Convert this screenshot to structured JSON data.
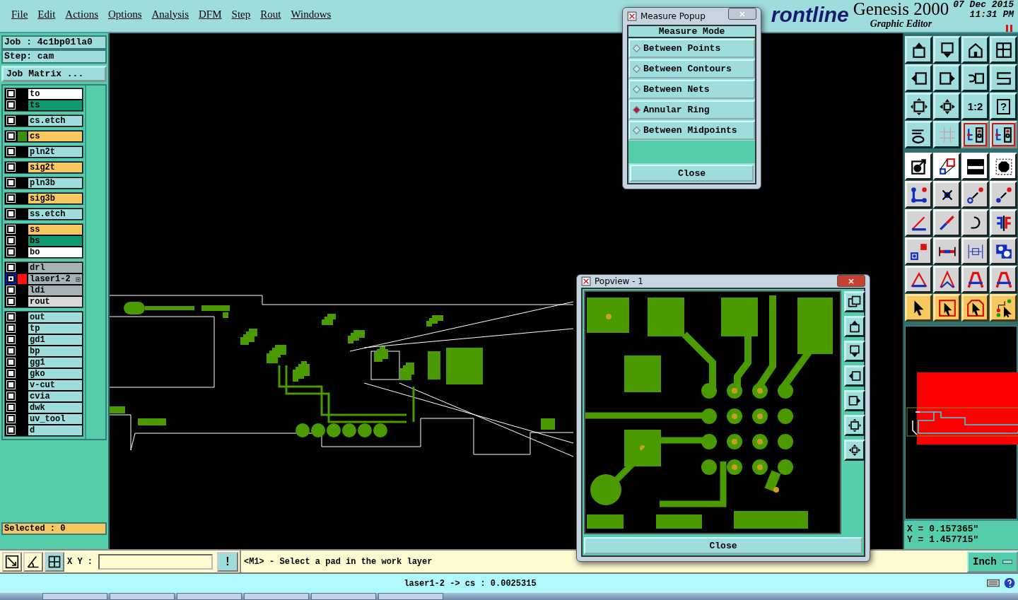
{
  "menu": [
    "File",
    "Edit",
    "Actions",
    "Options",
    "Analysis",
    "DFM",
    "Step",
    "Rout",
    "Windows"
  ],
  "header": {
    "logo": "rontline",
    "product": "Genesis 2000",
    "subtitle": "Graphic Editor",
    "date": "07 Dec 2015",
    "time": "11:31 PM"
  },
  "job": {
    "job": "Job : 4c1bp01la0",
    "step": "Step: cam",
    "matrix_button": "Job Matrix ..."
  },
  "layer_groups": [
    [
      {
        "name": "to",
        "color": "#ffffff",
        "selected": false,
        "expandable": false
      },
      {
        "name": "ts",
        "color": "#119a72",
        "selected": false,
        "expandable": false
      }
    ],
    [
      {
        "name": "cs.etch",
        "color": "#9fdcdc",
        "selected": false,
        "expandable": false
      }
    ],
    [
      {
        "name": "cs",
        "color": "#f8c860",
        "selected": false,
        "expandable": false,
        "marker": {
          "color": "#3c9010"
        }
      }
    ],
    [
      {
        "name": "pln2t",
        "color": "#9fdcdc",
        "selected": false,
        "expandable": false
      }
    ],
    [
      {
        "name": "sig2t",
        "color": "#f8c860",
        "selected": false,
        "expandable": false
      }
    ],
    [
      {
        "name": "pln3b",
        "color": "#9fdcdc",
        "selected": false,
        "expandable": false
      }
    ],
    [
      {
        "name": "sig3b",
        "color": "#f8c860",
        "selected": false,
        "expandable": false
      }
    ],
    [
      {
        "name": "ss.etch",
        "color": "#9fdcdc",
        "selected": false,
        "expandable": false
      }
    ],
    [
      {
        "name": "ss",
        "color": "#f8c860",
        "selected": false,
        "expandable": false
      },
      {
        "name": "bs",
        "color": "#119a72",
        "selected": false,
        "expandable": false
      },
      {
        "name": "bo",
        "color": "#ffffff",
        "selected": false,
        "expandable": false
      }
    ],
    [
      {
        "name": "drl",
        "color": "#a3b3b8",
        "selected": false,
        "expandable": false
      },
      {
        "name": "laser1-2",
        "color": "#a3b3b8",
        "selected": true,
        "expandable": true,
        "marker": {
          "color": "#ff1010"
        }
      },
      {
        "name": "ldi",
        "color": "#a3b3b8",
        "selected": false,
        "expandable": false
      },
      {
        "name": "rout",
        "color": "#d8d8d8",
        "selected": false,
        "expandable": false
      }
    ],
    [
      {
        "name": "out",
        "color": "#9fdcdc",
        "selected": false,
        "expandable": false
      },
      {
        "name": "tp",
        "color": "#9fdcdc",
        "selected": false,
        "expandable": false
      },
      {
        "name": "gd1",
        "color": "#9fdcdc",
        "selected": false,
        "expandable": false
      },
      {
        "name": "bp",
        "color": "#9fdcdc",
        "selected": false,
        "expandable": false
      },
      {
        "name": "gg1",
        "color": "#9fdcdc",
        "selected": false,
        "expandable": false
      },
      {
        "name": "gko",
        "color": "#9fdcdc",
        "selected": false,
        "expandable": false
      },
      {
        "name": "v-cut",
        "color": "#9fdcdc",
        "selected": false,
        "expandable": false
      },
      {
        "name": "cvia",
        "color": "#9fdcdc",
        "selected": false,
        "expandable": false
      },
      {
        "name": "dwk",
        "color": "#9fdcdc",
        "selected": false,
        "expandable": false
      },
      {
        "name": "uv_tool",
        "color": "#9fdcdc",
        "selected": false,
        "expandable": false
      },
      {
        "name": "d",
        "color": "#9fdcdc",
        "selected": false,
        "expandable": false
      }
    ]
  ],
  "selected_count": "Selected : 0",
  "toolbar": {
    "ratio_label": "1:2",
    "help_label": "?"
  },
  "coordinates": {
    "x": "X = 0.157365\"",
    "y": "Y = 1.457715\""
  },
  "command_bar": {
    "xy_label": "X Y :",
    "alert_button": "!",
    "prompt": "<M1> - Select a pad in the work layer",
    "units_button": "Inch"
  },
  "status_bar": "laser1-2 -> cs : 0.0025315",
  "measure_popup": {
    "title": "Measure Popup",
    "header": "Measure Mode",
    "options": [
      {
        "label": "Between Points",
        "selected": false
      },
      {
        "label": "Between Contours",
        "selected": false
      },
      {
        "label": "Between Nets",
        "selected": false
      },
      {
        "label": "Annular Ring",
        "selected": true
      },
      {
        "label": "Between Midpoints",
        "selected": false
      }
    ],
    "close": "Close"
  },
  "popview": {
    "title": "Popview - 1",
    "close": "Close"
  }
}
